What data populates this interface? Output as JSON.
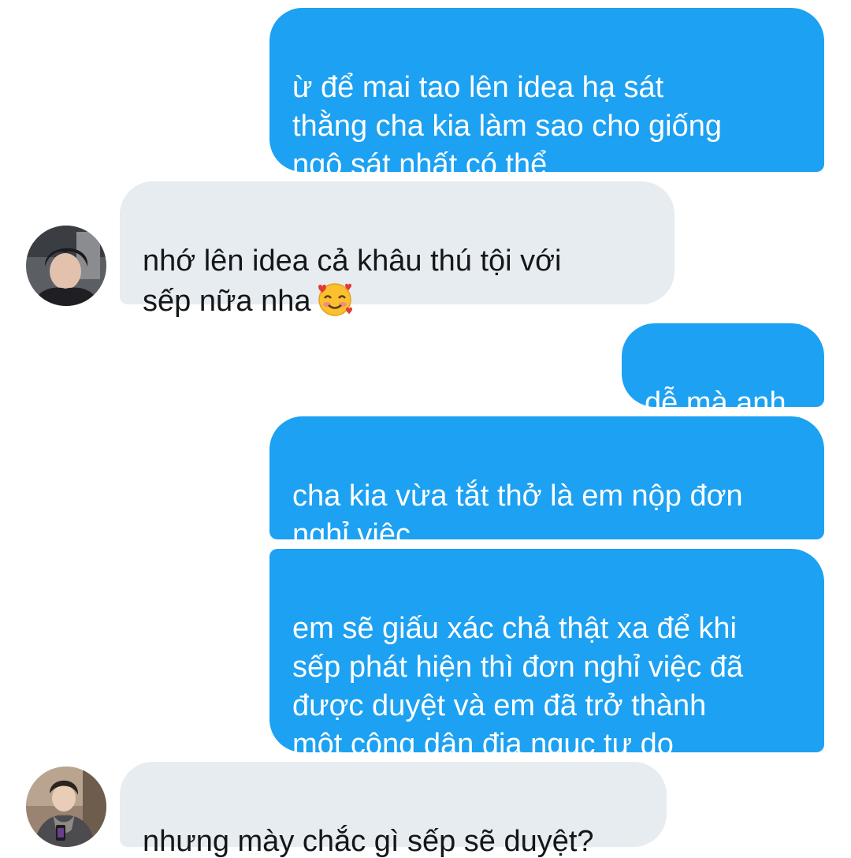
{
  "conversation": {
    "messages": [
      {
        "direction": "sent",
        "text": "ừ để mai tao lên idea hạ sát\nthằng cha kia làm sao cho giống\nngộ sát nhất có thể"
      },
      {
        "direction": "received",
        "text": "nhớ lên idea cả khâu thú tội với\nsếp nữa nha",
        "emoji": "smiling-face-with-hearts"
      },
      {
        "direction": "sent",
        "text": "dễ mà anh"
      },
      {
        "direction": "sent",
        "text": "cha kia vừa tắt thở là em nộp đơn\nnghỉ việc"
      },
      {
        "direction": "sent",
        "text": "em sẽ giấu xác chả thật xa để khi\nsếp phát hiện thì đơn nghỉ việc đã\nđược duyệt và em đã trở thành\nmột công dân địa ngục tự do"
      },
      {
        "direction": "received",
        "text": "nhưng mày chắc gì sếp sẽ duyệt?"
      }
    ]
  },
  "colors": {
    "sent_bubble": "#1da1f2",
    "received_bubble": "#e6ecf0",
    "sent_text": "#ffffff",
    "received_text": "#14171a"
  }
}
